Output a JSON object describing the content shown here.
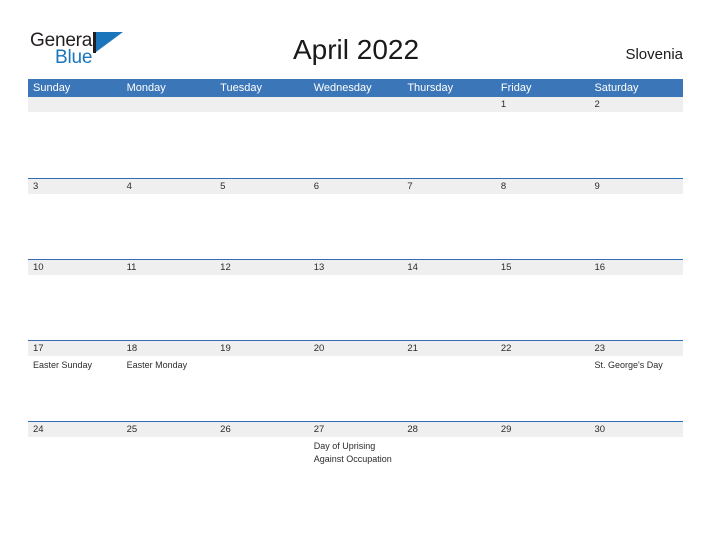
{
  "brand": {
    "name_part1": "General",
    "name_part2": "Blue",
    "flag_icon": "flag-triangle-icon",
    "colors": {
      "dark": "#231f20",
      "blue": "#1b75bb"
    }
  },
  "header": {
    "title": "April 2022",
    "region": "Slovenia"
  },
  "theme": {
    "header_blue": "#3a76b8",
    "row_divider_blue": "#2f6eb5",
    "day_band_gray": "#efefef",
    "text_dark": "#2b2b2b",
    "page_background": "#ffffff"
  },
  "calendar": {
    "weekdays": [
      "Sunday",
      "Monday",
      "Tuesday",
      "Wednesday",
      "Thursday",
      "Friday",
      "Saturday"
    ],
    "weeks": [
      {
        "days": [
          {
            "date": "",
            "event": ""
          },
          {
            "date": "",
            "event": ""
          },
          {
            "date": "",
            "event": ""
          },
          {
            "date": "",
            "event": ""
          },
          {
            "date": "",
            "event": ""
          },
          {
            "date": "1",
            "event": ""
          },
          {
            "date": "2",
            "event": ""
          }
        ]
      },
      {
        "days": [
          {
            "date": "3",
            "event": ""
          },
          {
            "date": "4",
            "event": ""
          },
          {
            "date": "5",
            "event": ""
          },
          {
            "date": "6",
            "event": ""
          },
          {
            "date": "7",
            "event": ""
          },
          {
            "date": "8",
            "event": ""
          },
          {
            "date": "9",
            "event": ""
          }
        ]
      },
      {
        "days": [
          {
            "date": "10",
            "event": ""
          },
          {
            "date": "11",
            "event": ""
          },
          {
            "date": "12",
            "event": ""
          },
          {
            "date": "13",
            "event": ""
          },
          {
            "date": "14",
            "event": ""
          },
          {
            "date": "15",
            "event": ""
          },
          {
            "date": "16",
            "event": ""
          }
        ]
      },
      {
        "days": [
          {
            "date": "17",
            "event": "Easter Sunday"
          },
          {
            "date": "18",
            "event": "Easter Monday"
          },
          {
            "date": "19",
            "event": ""
          },
          {
            "date": "20",
            "event": ""
          },
          {
            "date": "21",
            "event": ""
          },
          {
            "date": "22",
            "event": ""
          },
          {
            "date": "23",
            "event": "St. George's Day"
          }
        ]
      },
      {
        "days": [
          {
            "date": "24",
            "event": ""
          },
          {
            "date": "25",
            "event": ""
          },
          {
            "date": "26",
            "event": ""
          },
          {
            "date": "27",
            "event": "Day of Uprising\nAgainst Occupation"
          },
          {
            "date": "28",
            "event": ""
          },
          {
            "date": "29",
            "event": ""
          },
          {
            "date": "30",
            "event": ""
          }
        ]
      }
    ]
  }
}
